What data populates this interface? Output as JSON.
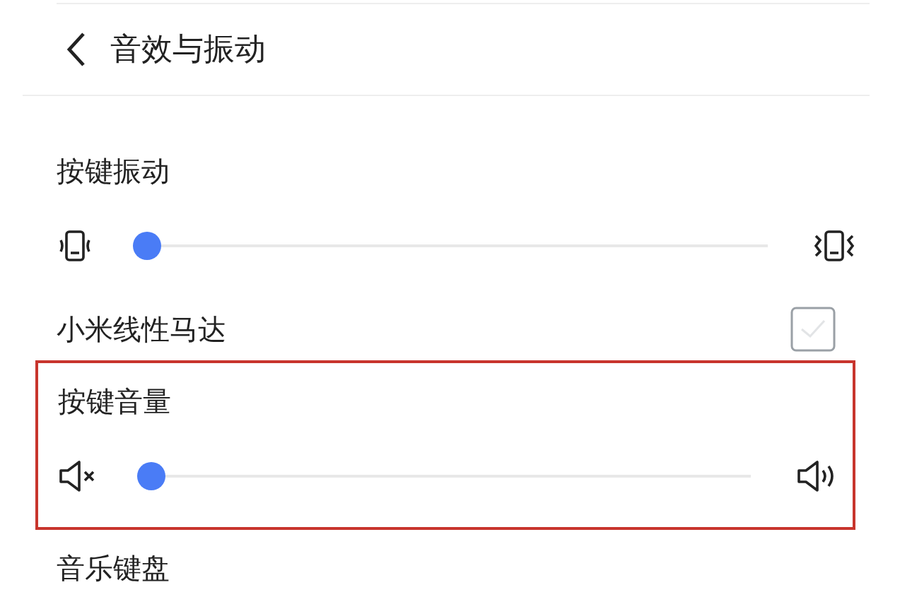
{
  "header": {
    "title": "音效与振动"
  },
  "items": [
    {
      "kind": "vibration-slider",
      "label": "按键振动",
      "level": 0.0,
      "highlighted": false
    },
    {
      "kind": "checkbox",
      "label": "小米线性马达",
      "checked": true,
      "disabled": true,
      "highlighted": false
    },
    {
      "kind": "volume-slider",
      "label": "按键音量",
      "level": 0.0,
      "highlighted": true
    },
    {
      "kind": "text",
      "label": "音乐键盘",
      "highlighted": false
    }
  ]
}
